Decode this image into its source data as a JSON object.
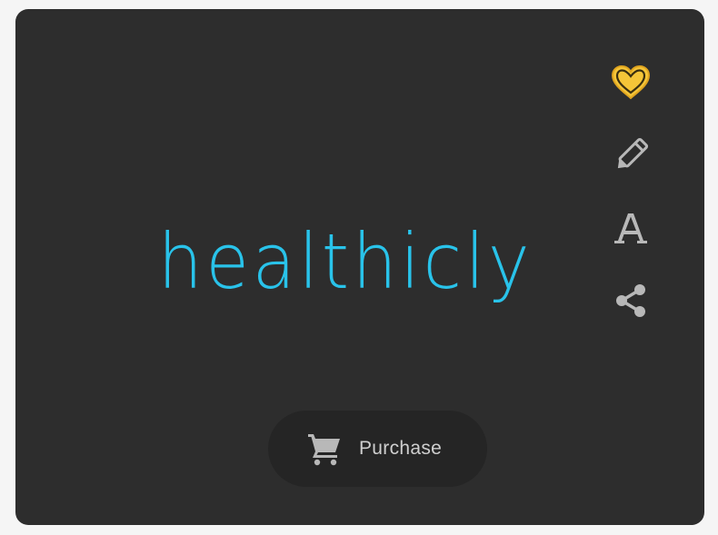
{
  "wordmark": {
    "text": "healthicly",
    "color": "#29c3ea"
  },
  "toolbar": {
    "items": [
      {
        "icon": "heart-icon",
        "color": "#f5c538"
      },
      {
        "icon": "pencil-icon",
        "color": "#b8b8b8"
      },
      {
        "icon": "font-icon",
        "color": "#b8b8b8"
      },
      {
        "icon": "share-icon",
        "color": "#b8b8b8"
      }
    ]
  },
  "purchase": {
    "icon": "cart-icon",
    "label": "Purchase"
  },
  "colors": {
    "card_background": "#2d2d2d",
    "page_background": "#f5f5f5",
    "button_background": "#252525"
  }
}
